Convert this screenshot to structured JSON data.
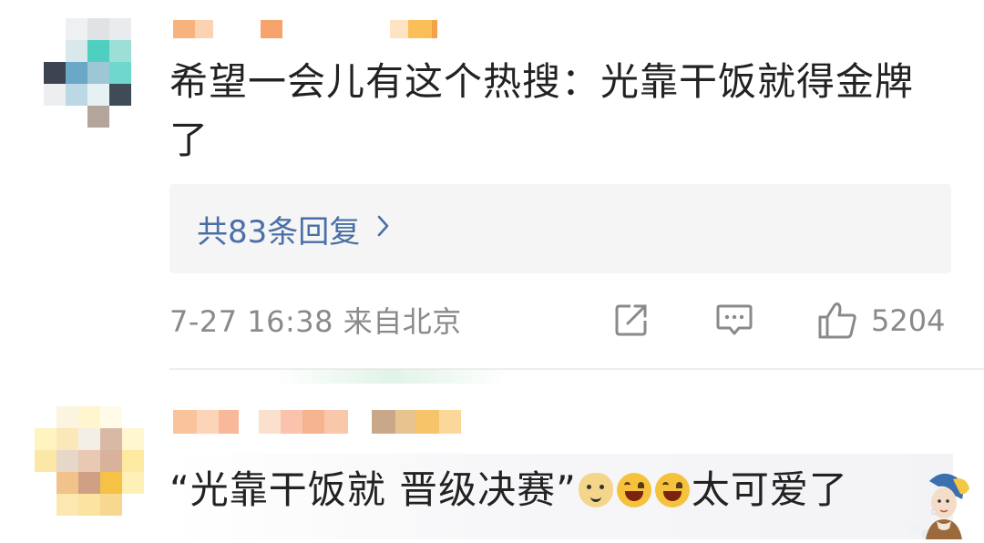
{
  "comment1": {
    "text": "希望一会儿有这个热搜：光靠干饭就得金牌了",
    "replies_label": "共83条回复",
    "timestamp": "7-27 16:38",
    "location": "来自北京",
    "like_count": "5204",
    "icons": [
      "share-icon",
      "comment-icon",
      "like-icon",
      "chevron-right-icon"
    ]
  },
  "comment2": {
    "text_part1": "“光靠干饭就 晋级决赛”",
    "text_part2": "太可爱了",
    "emojis": [
      "doge-emoji",
      "laugh-emoji",
      "laugh-emoji"
    ]
  },
  "colors": {
    "link": "#4a6ea8",
    "meta": "#8a8a8a",
    "reply_bg": "#f5f5f5"
  }
}
